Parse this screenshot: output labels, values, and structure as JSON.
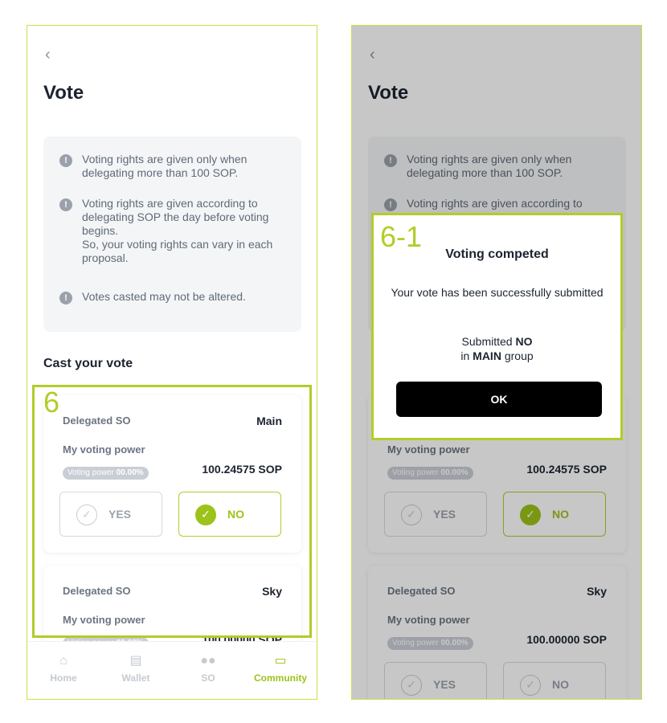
{
  "left": {
    "title": "Vote",
    "notices": [
      "Voting rights are given only when\ndelegating more than 100 SOP.",
      "Voting rights are given according to\ndelegating SOP the day before voting\nbegins.\nSo, your voting rights can vary in each\nproposal.",
      "Votes casted may not be altered."
    ],
    "section_title": "Cast your vote",
    "cards": [
      {
        "label": "Delegated SO",
        "group": "Main",
        "power_label": "My voting power",
        "badge_label": "Voting power",
        "badge_value": "00.00%",
        "amount": "100.24575 SOP",
        "yes": "YES",
        "no": "NO",
        "selected": "no"
      },
      {
        "label": "Delegated SO",
        "group": "Sky",
        "power_label": "My voting power",
        "badge_label": "Voting power",
        "badge_value": "00.00%",
        "amount": "100.00000 SOP",
        "yes": "YES",
        "no": "NO",
        "selected": "none"
      }
    ],
    "annotation": "6"
  },
  "right": {
    "title": "Vote",
    "notices": [
      "Voting rights are given only when\ndelegating more than 100 SOP.",
      "Voting rights are given according to\ndelegating SOP the day before voting"
    ],
    "section_title": "Cast your vote",
    "cards": [
      {
        "label": "Delegated SO",
        "group": "Main",
        "power_label": "My voting power",
        "badge_label": "Voting power",
        "badge_value": "00.00%",
        "amount": "100.24575 SOP",
        "yes": "YES",
        "no": "NO",
        "selected": "no"
      },
      {
        "label": "Delegated SO",
        "group": "Sky",
        "power_label": "My voting power",
        "badge_label": "Voting power",
        "badge_value": "00.00%",
        "amount": "100.00000 SOP",
        "yes": "YES",
        "no": "NO",
        "selected": "none"
      }
    ],
    "modal": {
      "annotation": "6-1",
      "title": "Voting competed",
      "message": "Your vote has been successfully submitted",
      "submitted_prefix": "Submitted",
      "submitted_choice": "NO",
      "group_prefix": "in",
      "group_name": "MAIN",
      "group_suffix": "group",
      "ok_label": "OK"
    }
  },
  "nav": [
    {
      "label": "Home",
      "icon": "home-icon"
    },
    {
      "label": "Wallet",
      "icon": "wallet-icon"
    },
    {
      "label": "SO",
      "icon": "people-icon"
    },
    {
      "label": "Community",
      "icon": "chat-icon",
      "active": true
    }
  ],
  "colors": {
    "accent": "#9dc21a",
    "annotation": "#b3cc29",
    "text": "#1c2430"
  }
}
